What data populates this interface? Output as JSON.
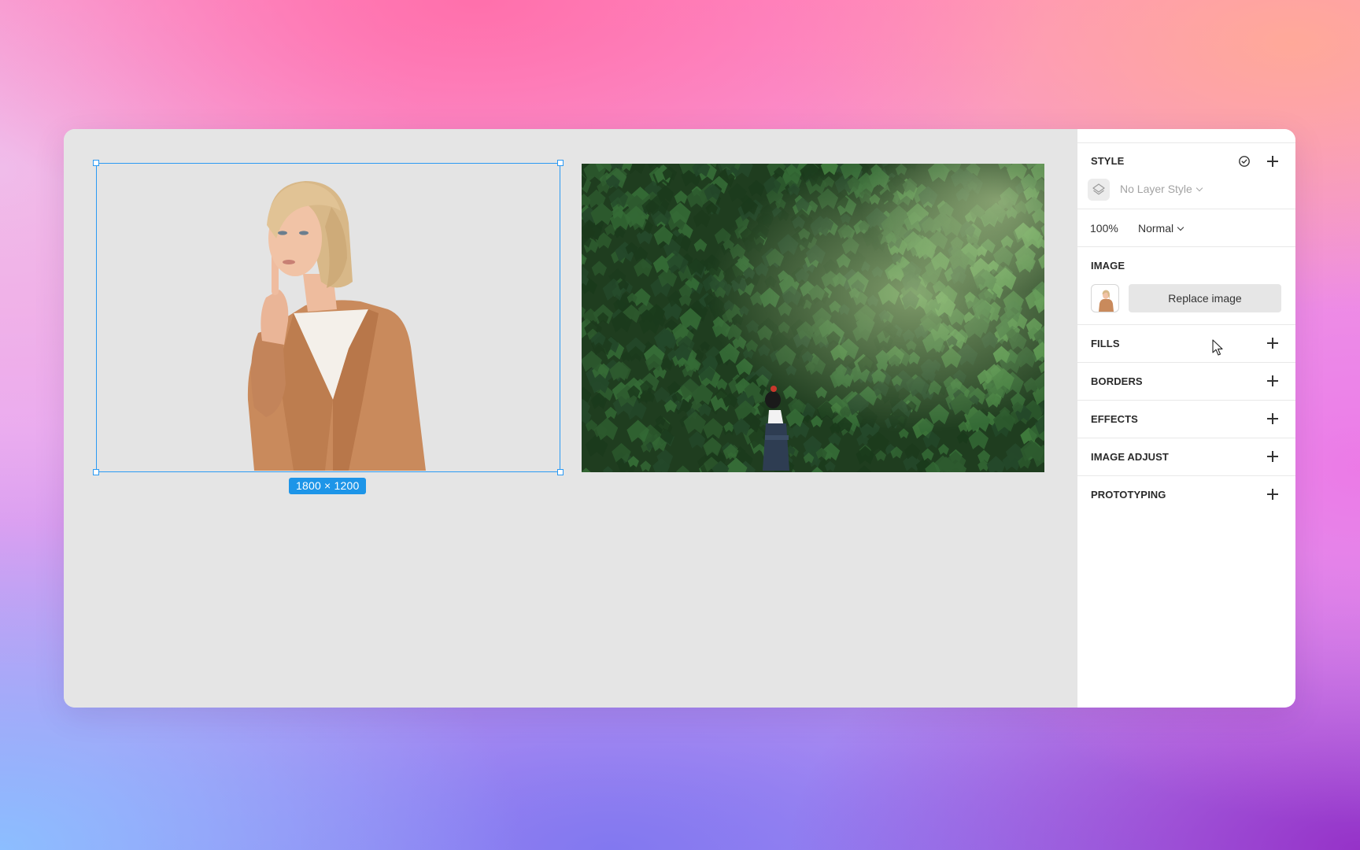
{
  "canvas": {
    "size_badge": "1800 × 1200"
  },
  "inspector": {
    "style": {
      "title": "STYLE",
      "layer_style": "No Layer Style",
      "opacity": "100%",
      "blend_mode": "Normal"
    },
    "image": {
      "title": "IMAGE",
      "replace_label": "Replace image"
    },
    "sections": {
      "fills": "FILLS",
      "borders": "BORDERS",
      "effects": "EFFECTS",
      "image_adjust": "IMAGE ADJUST",
      "prototyping": "PROTOTYPING"
    }
  },
  "colors": {
    "selection": "#2b9af3",
    "badge": "#1d95e8",
    "canvas": "#e5e5e5",
    "panel": "#ffffff"
  },
  "icons": {
    "sync": "check-circle-icon",
    "layer_style": "layers-icon",
    "add": "plus-icon",
    "cursor": "pointer-cursor-icon"
  }
}
